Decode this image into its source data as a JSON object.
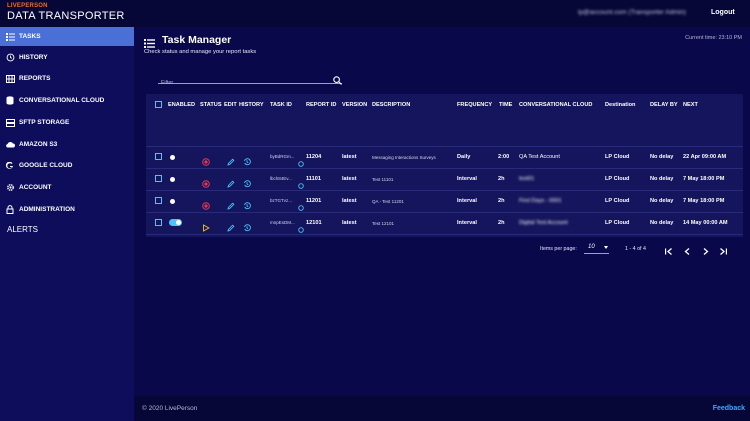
{
  "header": {
    "brand_small": "LIVEPERSON",
    "brand_title": "DATA TRANSPORTER",
    "user_label": "lp@account.com (Transporter Admin)",
    "logout_label": "Logout"
  },
  "sidebar": {
    "items": [
      {
        "label": "TASKS",
        "icon": "task-list-icon",
        "active": true
      },
      {
        "label": "HISTORY",
        "icon": "history-icon"
      },
      {
        "label": "REPORTS",
        "icon": "grid-icon"
      },
      {
        "label": "CONVERSATIONAL CLOUD",
        "icon": "database-icon"
      },
      {
        "label": "SFTP STORAGE",
        "icon": "server-icon"
      },
      {
        "label": "AMAZON S3",
        "icon": "cloud-icon"
      },
      {
        "label": "GOOGLE CLOUD",
        "icon": "google-icon"
      },
      {
        "label": "ACCOUNT",
        "icon": "gear-icon"
      },
      {
        "label": "ADMINISTRATION",
        "icon": "lock-icon"
      }
    ],
    "alerts_label": "ALERTS"
  },
  "page": {
    "title": "Task Manager",
    "subtitle": "Check status and manage your report tasks",
    "current_time": "Current time: 23:10 PM"
  },
  "filter": {
    "placeholder": "Filter",
    "value": ""
  },
  "table": {
    "columns": [
      "ENABLED",
      "STATUS",
      "EDIT",
      "HISTORY",
      "TASK ID",
      "REPORT ID",
      "VERSION",
      "DESCRIPTION",
      "FREQUENCY",
      "TIME",
      "CONVERSATIONAL CLOUD",
      "Destination",
      "DELAY BY",
      "NEXT"
    ],
    "rows": [
      {
        "task_id": "byBdRGm...",
        "report_id": "11204",
        "version": "latest",
        "description": "Messaging Interactions Surveys",
        "frequency": "Daily",
        "time": "2:00",
        "cc": "QA Test Account",
        "destination": "LP Cloud",
        "delay": "No delay",
        "next": "22 Apr 09:00 AM",
        "enabled": false,
        "status": "error"
      },
      {
        "task_id": "lbch84Ev...",
        "report_id": "11101",
        "version": "latest",
        "description": "Test 11101",
        "frequency": "Interval",
        "time": "2h",
        "cc": "test01",
        "destination": "LP Cloud",
        "delay": "No delay",
        "next": "7 May 18:00 PM",
        "enabled": false,
        "status": "error"
      },
      {
        "task_id": "bzTGTvz...",
        "report_id": "11201",
        "version": "latest",
        "description": "QA - Test 11201",
        "frequency": "Interval",
        "time": "2h",
        "cc": "First Days - 0001",
        "destination": "LP Cloud",
        "delay": "No delay",
        "next": "7 May 18:00 PM",
        "enabled": false,
        "status": "error"
      },
      {
        "task_id": "mnpEsDM...",
        "report_id": "12101",
        "version": "latest",
        "description": "Test 12101",
        "frequency": "Interval",
        "time": "2h",
        "cc": "Digital Test Account",
        "destination": "LP Cloud",
        "delay": "No delay",
        "next": "14 May 00:00 AM",
        "enabled": true,
        "status": "play"
      }
    ]
  },
  "pagination": {
    "items_per_page_label": "Items per page:",
    "page_size": "10",
    "range_label": "1 - 4 of 4"
  },
  "footer": {
    "copyright": "© 2020 LivePerson",
    "feedback_label": "Feedback"
  },
  "colors": {
    "background": "#08084a",
    "sidebar": "#0d0d5c",
    "active": "#4a6fd6",
    "accent": "#4fc3f7",
    "error": "#e53950",
    "play": "#f5c518"
  }
}
